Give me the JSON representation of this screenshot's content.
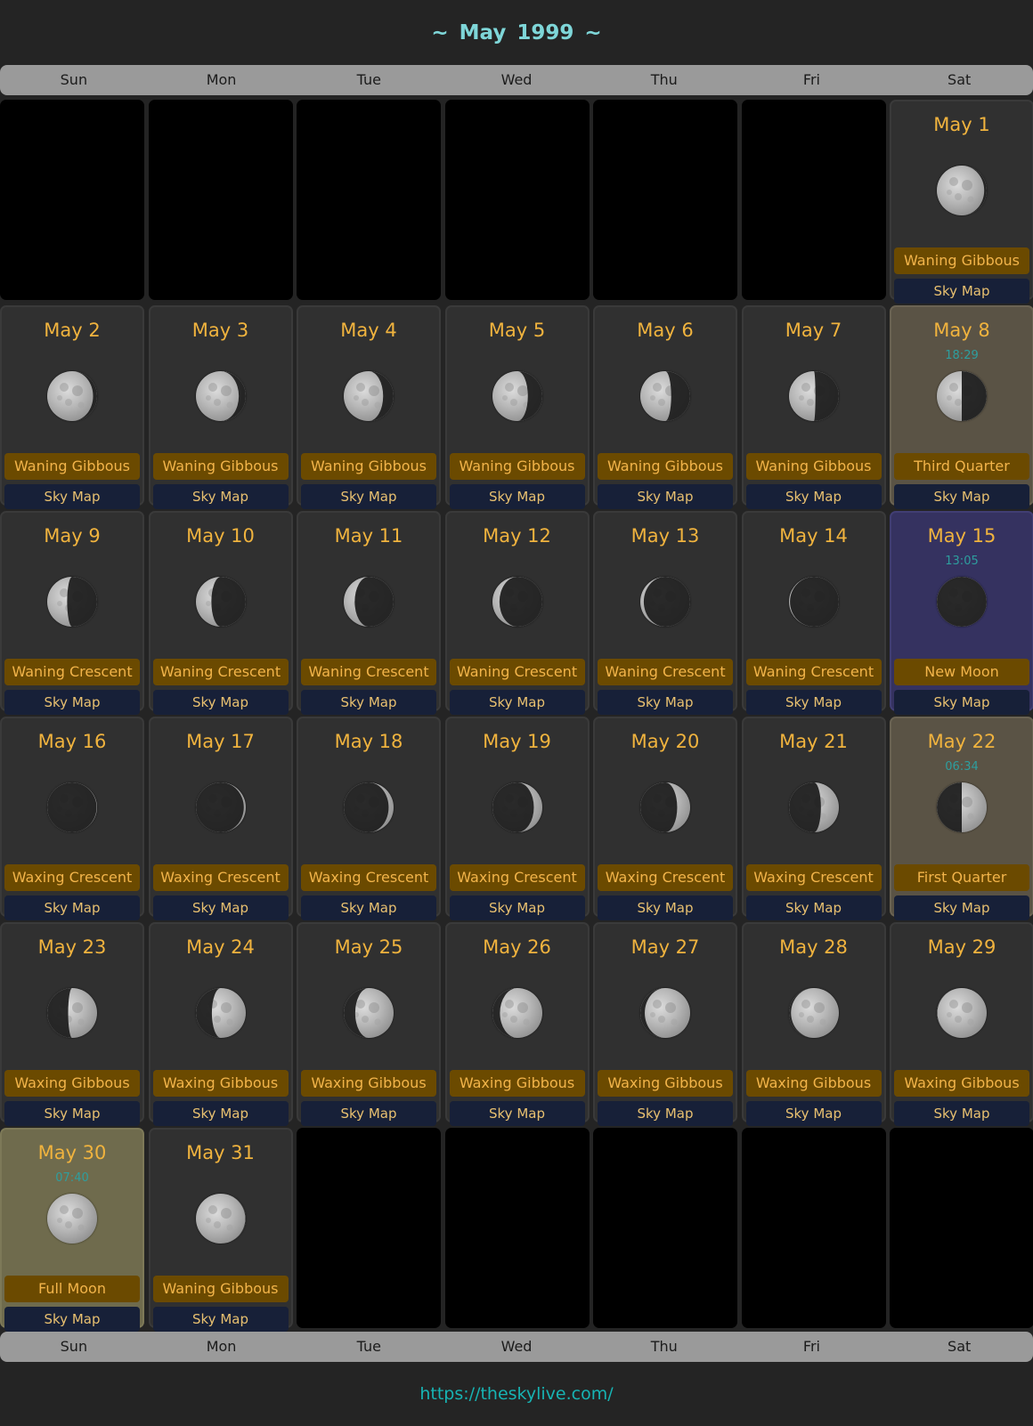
{
  "header": {
    "tilde_left": "~",
    "month_title": "May 1999",
    "tilde_right": "~"
  },
  "weekdays": [
    "Sun",
    "Mon",
    "Tue",
    "Wed",
    "Thu",
    "Fri",
    "Sat"
  ],
  "sky_map_label": "Sky Map",
  "leading_empty_days": 6,
  "days": [
    {
      "date": "May 1",
      "phase": "Waning Gibbous",
      "illum": 0.95,
      "waxing": false
    },
    {
      "date": "May 2",
      "phase": "Waning Gibbous",
      "illum": 0.92,
      "waxing": false
    },
    {
      "date": "May 3",
      "phase": "Waning Gibbous",
      "illum": 0.86,
      "waxing": false
    },
    {
      "date": "May 4",
      "phase": "Waning Gibbous",
      "illum": 0.79,
      "waxing": false
    },
    {
      "date": "May 5",
      "phase": "Waning Gibbous",
      "illum": 0.71,
      "waxing": false
    },
    {
      "date": "May 6",
      "phase": "Waning Gibbous",
      "illum": 0.62,
      "waxing": false
    },
    {
      "date": "May 7",
      "phase": "Waning Gibbous",
      "illum": 0.53,
      "waxing": false
    },
    {
      "date": "May 8",
      "phase": "Third Quarter",
      "illum": 0.5,
      "waxing": false,
      "time": "18:29",
      "highlight": "quarter"
    },
    {
      "date": "May 9",
      "phase": "Waning Crescent",
      "illum": 0.4,
      "waxing": false
    },
    {
      "date": "May 10",
      "phase": "Waning Crescent",
      "illum": 0.31,
      "waxing": false
    },
    {
      "date": "May 11",
      "phase": "Waning Crescent",
      "illum": 0.22,
      "waxing": false
    },
    {
      "date": "May 12",
      "phase": "Waning Crescent",
      "illum": 0.14,
      "waxing": false
    },
    {
      "date": "May 13",
      "phase": "Waning Crescent",
      "illum": 0.07,
      "waxing": false
    },
    {
      "date": "May 14",
      "phase": "Waning Crescent",
      "illum": 0.02,
      "waxing": false
    },
    {
      "date": "May 15",
      "phase": "New Moon",
      "illum": 0.0,
      "waxing": true,
      "time": "13:05",
      "highlight": "newmoon"
    },
    {
      "date": "May 16",
      "phase": "Waxing Crescent",
      "illum": 0.01,
      "waxing": true
    },
    {
      "date": "May 17",
      "phase": "Waxing Crescent",
      "illum": 0.04,
      "waxing": true
    },
    {
      "date": "May 18",
      "phase": "Waxing Crescent",
      "illum": 0.1,
      "waxing": true
    },
    {
      "date": "May 19",
      "phase": "Waxing Crescent",
      "illum": 0.17,
      "waxing": true
    },
    {
      "date": "May 20",
      "phase": "Waxing Crescent",
      "illum": 0.26,
      "waxing": true
    },
    {
      "date": "May 21",
      "phase": "Waxing Crescent",
      "illum": 0.36,
      "waxing": true
    },
    {
      "date": "May 22",
      "phase": "First Quarter",
      "illum": 0.5,
      "waxing": true,
      "time": "06:34",
      "highlight": "quarter"
    },
    {
      "date": "May 23",
      "phase": "Waxing Gibbous",
      "illum": 0.58,
      "waxing": true
    },
    {
      "date": "May 24",
      "phase": "Waxing Gibbous",
      "illum": 0.68,
      "waxing": true
    },
    {
      "date": "May 25",
      "phase": "Waxing Gibbous",
      "illum": 0.77,
      "waxing": true
    },
    {
      "date": "May 26",
      "phase": "Waxing Gibbous",
      "illum": 0.85,
      "waxing": true
    },
    {
      "date": "May 27",
      "phase": "Waxing Gibbous",
      "illum": 0.91,
      "waxing": true
    },
    {
      "date": "May 28",
      "phase": "Waxing Gibbous",
      "illum": 0.96,
      "waxing": true
    },
    {
      "date": "May 29",
      "phase": "Waxing Gibbous",
      "illum": 0.99,
      "waxing": true
    },
    {
      "date": "May 30",
      "phase": "Full Moon",
      "illum": 1.0,
      "waxing": false,
      "time": "07:40",
      "highlight": "fullmoon"
    },
    {
      "date": "May 31",
      "phase": "Waning Gibbous",
      "illum": 0.99,
      "waxing": false
    }
  ],
  "footer": {
    "url": "https://theskylive.com/"
  }
}
